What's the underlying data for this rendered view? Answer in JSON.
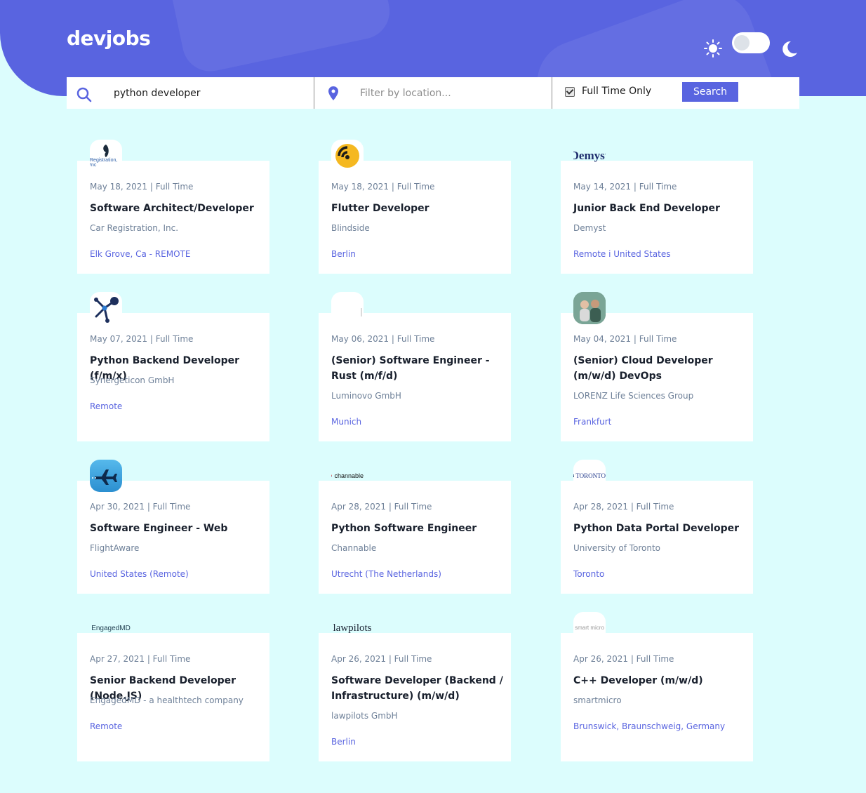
{
  "app": {
    "logo": "devjobs"
  },
  "theme": {
    "sun_icon": "sun-icon",
    "moon_icon": "moon-icon",
    "dark_mode": false
  },
  "search": {
    "query_value": "python developer",
    "location_placeholder": "Filter by location...",
    "full_time_label": "Full Time Only",
    "full_time_checked": true,
    "button_label": "Search"
  },
  "colors": {
    "accent": "#5964e0",
    "background": "#dcfdfd",
    "title": "#19202d",
    "muted": "#6e8098"
  },
  "jobs": [
    {
      "meta": "May 18, 2021 | Full Time",
      "title": "Software Architect/Developer",
      "company": "Car Registration, Inc.",
      "location": "Elk Grove, Ca - REMOTE",
      "logo_text": "Registration, Inc"
    },
    {
      "meta": "May 18, 2021 | Full Time",
      "title": "Flutter Developer",
      "company": "Blindside",
      "location": "Berlin"
    },
    {
      "meta": "May 14, 2021 | Full Time",
      "title": "Junior Back End Developer",
      "company": "Demyst",
      "location": "Remote i United States",
      "logo_text": "Demyst"
    },
    {
      "meta": "May 07, 2021 | Full Time",
      "title": "Python Backend Developer (f/m/x)",
      "company": "Synergeticon GmbH",
      "location": "Remote"
    },
    {
      "meta": "May 06, 2021 | Full Time",
      "title": "(Senior) Software Engineer - Rust (m/f/d)",
      "company": "Luminovo GmbH",
      "location": "Munich"
    },
    {
      "meta": "May 04, 2021 | Full Time",
      "title": "(Senior) Cloud Developer (m/w/d) DevOps",
      "company": "LORENZ Life Sciences Group",
      "location": "Frankfurt"
    },
    {
      "meta": "Apr 30, 2021 | Full Time",
      "title": "Software Engineer - Web",
      "company": "FlightAware",
      "location": "United States (Remote)"
    },
    {
      "meta": "Apr 28, 2021 | Full Time",
      "title": "Python Software Engineer",
      "company": "Channable",
      "location": "Utrecht (The Netherlands)",
      "logo_text": "channable"
    },
    {
      "meta": "Apr 28, 2021 | Full Time",
      "title": "Python Data Portal Developer",
      "company": "University of Toronto",
      "location": "Toronto",
      "logo_text": "TORONTO"
    },
    {
      "meta": "Apr 27, 2021 | Full Time",
      "title": "Senior Backend Developer (Node.JS)",
      "company": "EngagedMD - a healthtech company",
      "location": "Remote",
      "logo_text": "EngagedMD"
    },
    {
      "meta": "Apr 26, 2021 | Full Time",
      "title": "Software Developer (Backend / Infrastructure) (m/w/d)",
      "company": "lawpilots GmbH",
      "location": "Berlin",
      "logo_text": "lawpilots"
    },
    {
      "meta": "Apr 26, 2021 | Full Time",
      "title": "C++ Developer (m/w/d)",
      "company": "smartmicro",
      "location": "Brunswick, Braunschweig, Germany",
      "logo_text": "smart micro"
    }
  ]
}
